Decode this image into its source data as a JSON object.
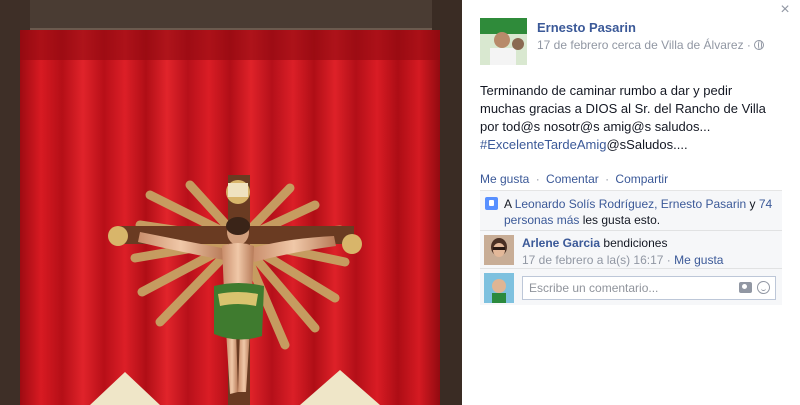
{
  "post": {
    "author": "Ernesto Pasarin",
    "meta": "17 de febrero cerca de Villa de Álvarez ·",
    "text": "Terminando de caminar rumbo a dar y pedir muchas gracias a DIOS al Sr. del Rancho de Villa por tod@s nosotr@s amig@s saludos...",
    "hashtag": "#ExcelenteTardeAmig",
    "text_after": "@sSaludos...."
  },
  "actions": {
    "like": "Me gusta",
    "comment": "Comentar",
    "share": "Compartir",
    "separator": "·"
  },
  "likes": {
    "prefix": "A ",
    "names": "Leonardo Solís Rodríguez, Ernesto Pasarin",
    "joiner": " y ",
    "others": "74 personas más",
    "suffix": " les gusta esto."
  },
  "comment": {
    "author": "Arlene Garcia",
    "text": "bendiciones",
    "time": "17 de febrero a la(s) 16:17 ·",
    "like": "Me gusta"
  },
  "compose": {
    "placeholder": "Escribe un comentario..."
  },
  "icons": {
    "close": "close-icon",
    "globe": "globe-icon",
    "like": "thumbs-up-icon",
    "camera": "camera-icon",
    "emoji": "smiley-icon"
  },
  "colors": {
    "link": "#3b5998",
    "muted": "#9197a3",
    "curtain": "#c4121c",
    "ufi_background": "#f6f7f9"
  }
}
